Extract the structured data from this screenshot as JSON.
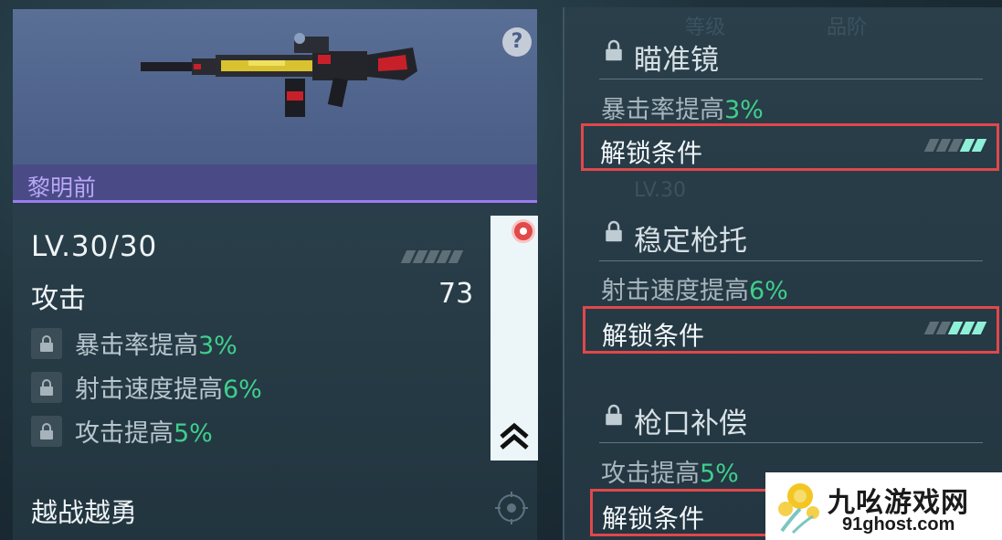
{
  "weapon": {
    "name": "黎明前",
    "level_text": "LV.30/30",
    "attack_label": "攻击",
    "attack_value": "73",
    "perks": [
      {
        "prefix": "暴击率提高",
        "value": "3%"
      },
      {
        "prefix": "射击速度提高",
        "value": "6%"
      },
      {
        "prefix": "攻击提高",
        "value": "5%"
      }
    ],
    "skill_name": "越战越勇"
  },
  "attachments": [
    {
      "title": "瞄准镜",
      "desc_prefix": "暴击率提高",
      "desc_value": "3%",
      "unlock_label": "解锁条件",
      "progress_lit": 2,
      "progress_total": 5
    },
    {
      "title": "稳定枪托",
      "desc_prefix": "射击速度提高",
      "desc_value": "6%",
      "unlock_label": "解锁条件",
      "progress_lit": 3,
      "progress_total": 5
    },
    {
      "title": "枪口补偿",
      "desc_prefix": "攻击提高",
      "desc_value": "5%",
      "unlock_label": "解锁条件"
    }
  ],
  "background_text": {
    "ghost_top_left": "等级",
    "ghost_top_right": "品阶",
    "ghost_level": "LV.30"
  },
  "watermark": {
    "title": "九吆游戏网",
    "url": "91ghost.com"
  },
  "colors": {
    "accent_green": "#3fcf8c",
    "highlight_red": "#e0484b",
    "name_bar_purple": "#9c7cf0",
    "stripe_lit": "#8ff0d8"
  },
  "icons": [
    "help-icon",
    "lock-icon",
    "target-icon",
    "double-chevron-up-icon",
    "notification-dot-icon"
  ]
}
